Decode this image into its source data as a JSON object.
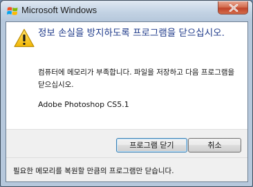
{
  "window": {
    "title": "Microsoft Windows",
    "icon": "windows-flag-icon",
    "close_icon": "close-icon"
  },
  "dialog": {
    "icon": "warning-icon",
    "main_instruction": "정보 손실을 방지하도록 프로그램을 닫으십시오.",
    "content": "컴퓨터에 메모리가 부족합니다. 파일을 저장하고 다음 프로그램을 닫으십시오.",
    "program_name": "Adobe Photoshop CS5.1"
  },
  "buttons": {
    "close_program": "프로그램 닫기",
    "cancel": "취소"
  },
  "footer": {
    "text": "필요한 메모리를 복원할 만큼의 프로그램만 닫습니다."
  },
  "colors": {
    "main_instruction": "#1e3a8a",
    "close_button": "#c0442a"
  }
}
